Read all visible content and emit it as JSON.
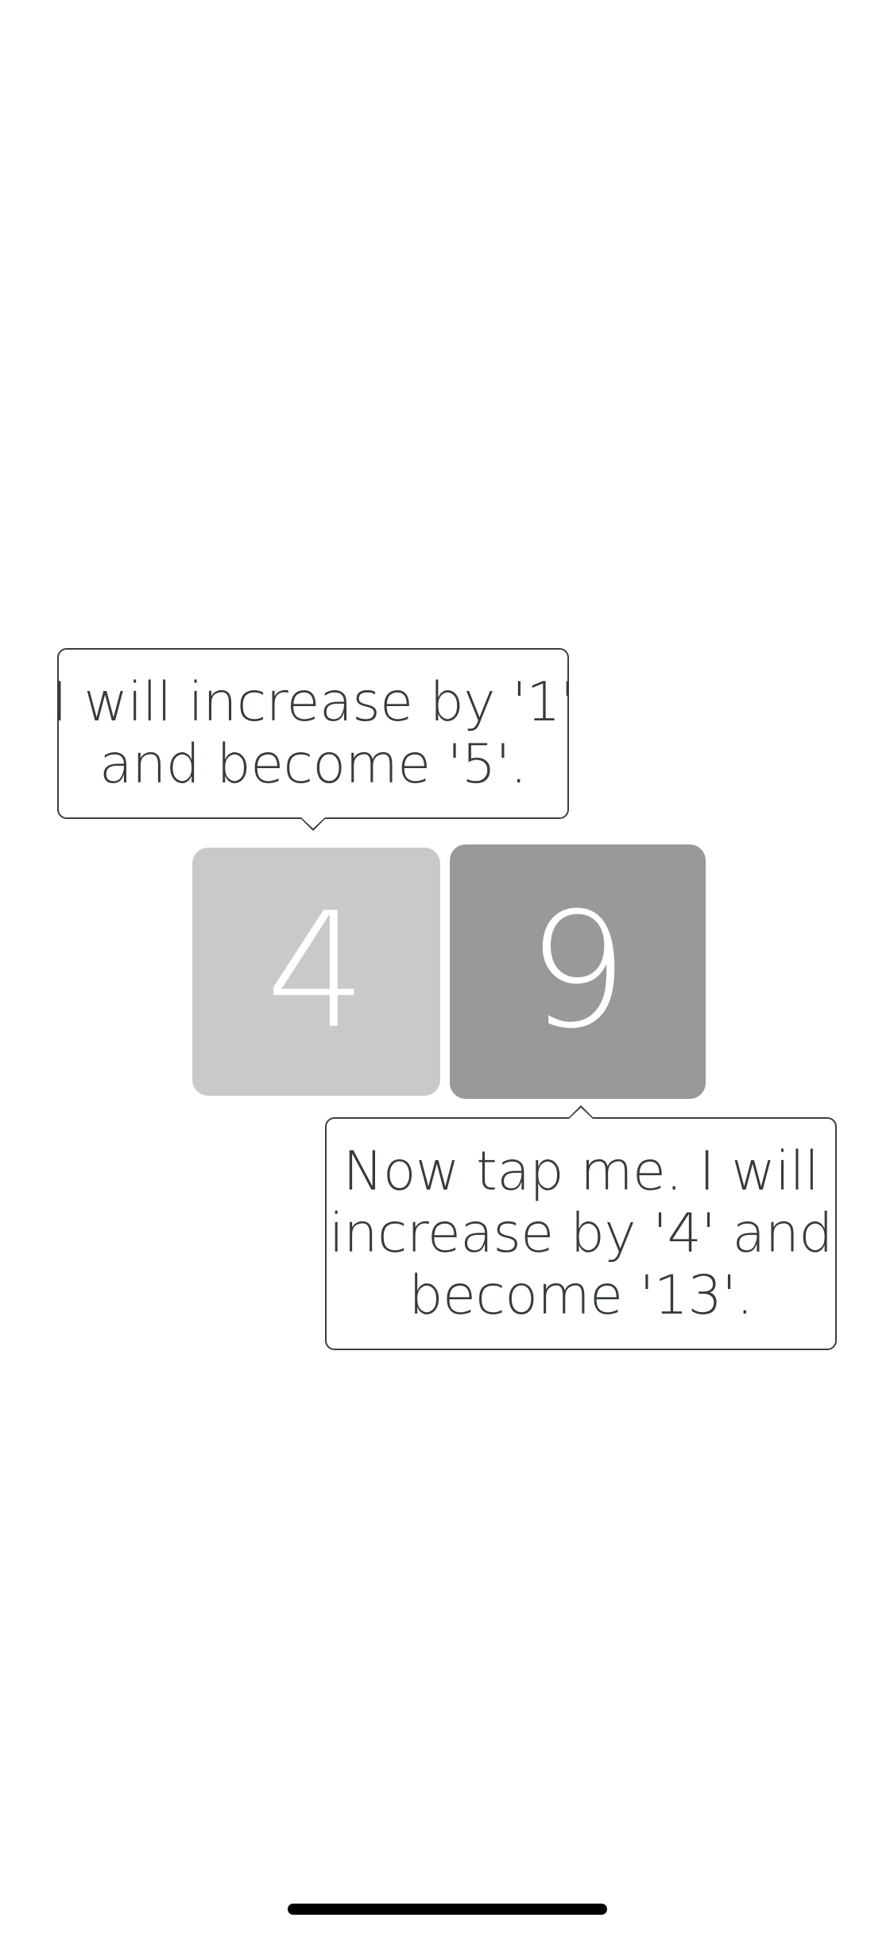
{
  "tiles": [
    {
      "value": "4",
      "color": "#c9c9c9"
    },
    {
      "value": "9",
      "color": "#999999"
    }
  ],
  "tooltips": {
    "top": {
      "lines": [
        "I will increase by '1'",
        "and become '5'."
      ]
    },
    "bottom": {
      "lines": [
        "Now tap me. I will",
        "increase by '4' and",
        "become '13'."
      ]
    }
  },
  "colors": {
    "background": "#ffffff",
    "text": "#353b3e",
    "border": "#3a3f42"
  }
}
